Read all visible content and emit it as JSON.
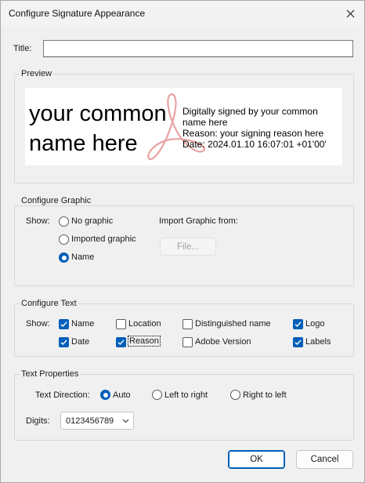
{
  "window": {
    "title": "Configure Signature Appearance",
    "close_icon": "close-icon"
  },
  "title_field": {
    "label": "Title:",
    "value": ""
  },
  "preview": {
    "group_title": "Preview",
    "name_line1": "your common",
    "name_line2": "name here",
    "details": [
      "Digitally signed by your common",
      "name here",
      "Reason: your signing reason here",
      "Date: 2024.01.10 16:07:01 +01'00'"
    ],
    "logo": "acrobat-logo-watermark"
  },
  "configure_graphic": {
    "group_title": "Configure Graphic",
    "show_label": "Show:",
    "options": [
      {
        "label": "No graphic",
        "selected": false
      },
      {
        "label": "Imported graphic",
        "selected": false
      },
      {
        "label": "Name",
        "selected": true
      }
    ],
    "import_label": "Import Graphic from:",
    "file_button": "File..."
  },
  "configure_text": {
    "group_title": "Configure Text",
    "show_label": "Show:",
    "items": [
      {
        "label": "Name",
        "checked": true
      },
      {
        "label": "Location",
        "checked": false
      },
      {
        "label": "Distinguished name",
        "checked": false
      },
      {
        "label": "Logo",
        "checked": true
      },
      {
        "label": "Date",
        "checked": true
      },
      {
        "label": "Reason",
        "checked": true
      },
      {
        "label": "Adobe Version",
        "checked": false
      },
      {
        "label": "Labels",
        "checked": true
      }
    ]
  },
  "text_properties": {
    "group_title": "Text Properties",
    "direction_label": "Text Direction:",
    "directions": [
      {
        "label": "Auto",
        "selected": true
      },
      {
        "label": "Left to right",
        "selected": false
      },
      {
        "label": "Right to left",
        "selected": false
      }
    ],
    "digits_label": "Digits:",
    "digits_value": "0123456789"
  },
  "buttons": {
    "ok": "OK",
    "cancel": "Cancel"
  },
  "colors": {
    "accent": "#005fb8",
    "logo": "#e8a3a3"
  }
}
